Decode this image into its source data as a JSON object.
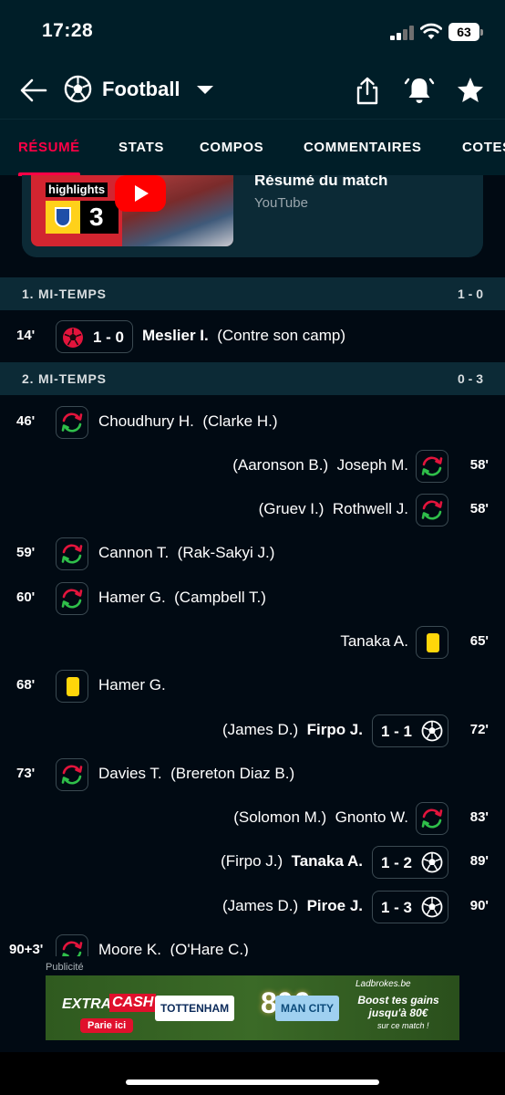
{
  "status_bar": {
    "time": "17:28",
    "battery": "63"
  },
  "header": {
    "title": "Football",
    "icons": [
      "back-arrow-icon",
      "soccer-ball-icon",
      "share-icon",
      "bell-icon",
      "star-icon"
    ]
  },
  "tabs": [
    {
      "label": "RÉSUMÉ",
      "active": true
    },
    {
      "label": "STATS",
      "active": false
    },
    {
      "label": "COMPOS",
      "active": false
    },
    {
      "label": "COMMENTAIRES",
      "active": false
    },
    {
      "label": "COTES",
      "active": false
    }
  ],
  "video": {
    "title": "Résumé du match",
    "source": "YouTube",
    "thumb_label": "highlights",
    "thumb_score": "3"
  },
  "sections": [
    {
      "title": "1. MI-TEMPS",
      "score": "1 - 0",
      "events": [
        {
          "minute": "14'",
          "type": "own-goal",
          "score": "1 - 0",
          "player": "Meslier I.",
          "detail": "(Contre son camp)"
        }
      ]
    },
    {
      "title": "2. MI-TEMPS",
      "score": "0 - 3",
      "events": [
        {
          "minute": "46'",
          "type": "substitution",
          "player": "Choudhury H.",
          "detail": "(Clarke H.)"
        },
        {
          "minute": "58'",
          "type": "substitution",
          "player": "Joseph M.",
          "detail": "(Aaronson B.)"
        },
        {
          "minute": "58'",
          "type": "substitution",
          "player": "Rothwell J.",
          "detail": "(Gruev I.)"
        },
        {
          "minute": "59'",
          "type": "substitution",
          "player": "Cannon T.",
          "detail": "(Rak-Sakyi J.)"
        },
        {
          "minute": "60'",
          "type": "substitution",
          "player": "Hamer G.",
          "detail": "(Campbell T.)"
        },
        {
          "minute": "65'",
          "type": "yellow-card",
          "player": "Tanaka A."
        },
        {
          "minute": "68'",
          "type": "yellow-card",
          "player": "Hamer G."
        },
        {
          "minute": "72'",
          "type": "goal",
          "score": "1 - 1",
          "player": "Firpo J.",
          "detail": "(James D.)"
        },
        {
          "minute": "73'",
          "type": "substitution",
          "player": "Davies T.",
          "detail": "(Brereton Diaz B.)"
        },
        {
          "minute": "83'",
          "type": "substitution",
          "player": "Gnonto W.",
          "detail": "(Solomon M.)"
        },
        {
          "minute": "89'",
          "type": "goal",
          "score": "1 - 2",
          "player": "Tanaka A.",
          "detail": "(Firpo J.)"
        },
        {
          "minute": "90'",
          "type": "goal",
          "score": "1 - 3",
          "player": "Piroe J.",
          "detail": "(James D.)"
        },
        {
          "minute": "90+3'",
          "type": "substitution",
          "player": "Moore K.",
          "detail": "(O'Hare C.)"
        }
      ]
    }
  ],
  "ad": {
    "label": "Publicité",
    "extra": "EXTRA",
    "cash": "CASH",
    "cta": "Parie ici",
    "team_home": "TOTTENHAM",
    "amount": "80€",
    "team_away": "MAN CITY",
    "brand": "Ladbrokes.be",
    "boost": "Boost tes gains jusqu'à 80€",
    "sub": "sur ce match !"
  },
  "colors": {
    "accent": "#ff0046",
    "background": "#010a13",
    "panel": "#0c2a36",
    "yellow_card": "#ffd60a"
  }
}
